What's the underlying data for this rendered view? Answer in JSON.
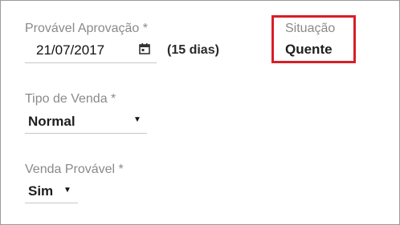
{
  "form": {
    "provavel_aprovacao": {
      "label": "Provável Aprovação *",
      "value": "21/07/2017",
      "days_note": "(15 dias)"
    },
    "situacao": {
      "label": "Situação",
      "value": "Quente",
      "highlight_color": "#d71f28"
    },
    "tipo_de_venda": {
      "label": "Tipo de Venda *",
      "selected": "Normal"
    },
    "venda_provavel": {
      "label": "Venda Provável *",
      "selected": "Sim"
    }
  },
  "icons": {
    "calendar": "calendar-icon",
    "dropdown": "caret-down-icon"
  }
}
